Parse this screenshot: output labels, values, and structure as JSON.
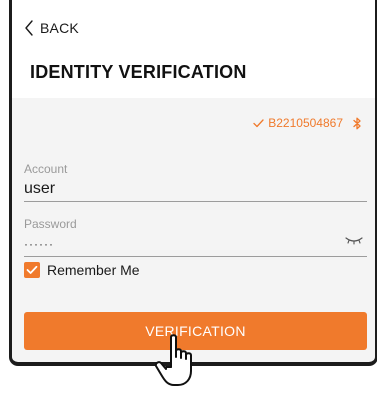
{
  "header": {
    "back_label": "BACK",
    "title": "IDENTITY VERIFICATION"
  },
  "device": {
    "serial": "B2210504867",
    "status_icon": "check-icon",
    "connection_icon": "bluetooth-icon",
    "accent_color": "#f07a2c"
  },
  "form": {
    "account": {
      "label": "Account",
      "value": "user"
    },
    "password": {
      "label": "Password",
      "value": "······",
      "toggle_icon": "eye-closed-icon"
    },
    "remember": {
      "label": "Remember Me",
      "checked": true
    }
  },
  "actions": {
    "verify_label": "VERIFICATION",
    "pointer_icon": "hand-pointer-icon"
  }
}
